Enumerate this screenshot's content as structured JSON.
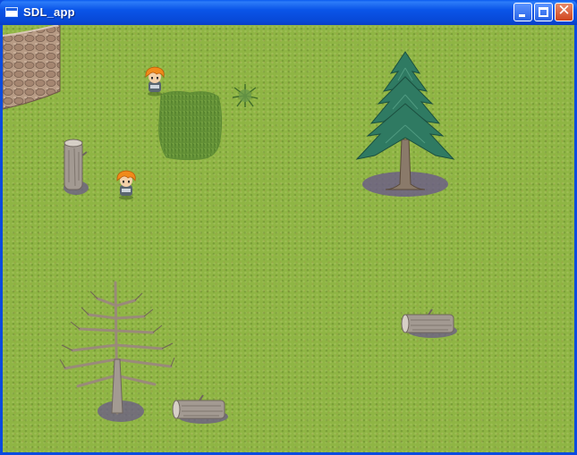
{
  "window": {
    "title": "SDL_app",
    "controls": {
      "minimize": "minimize",
      "maximize": "maximize",
      "close": "close"
    }
  },
  "scene": {
    "terrain": "grass",
    "objects": [
      {
        "kind": "stone-wall"
      },
      {
        "kind": "player-character"
      },
      {
        "kind": "npc-character"
      },
      {
        "kind": "tall-grass-patch"
      },
      {
        "kind": "small-bush"
      },
      {
        "kind": "fallen-log-vertical"
      },
      {
        "kind": "pine-tree"
      },
      {
        "kind": "dead-tree"
      },
      {
        "kind": "fallen-log-horizontal"
      },
      {
        "kind": "fallen-log-horizontal"
      }
    ]
  },
  "colors": {
    "grass": "#8fb544",
    "titlebar": "#0a54e8",
    "pine": "#2f7a62",
    "shadow": "#6a5a8a",
    "hair": "#f08a1a"
  }
}
